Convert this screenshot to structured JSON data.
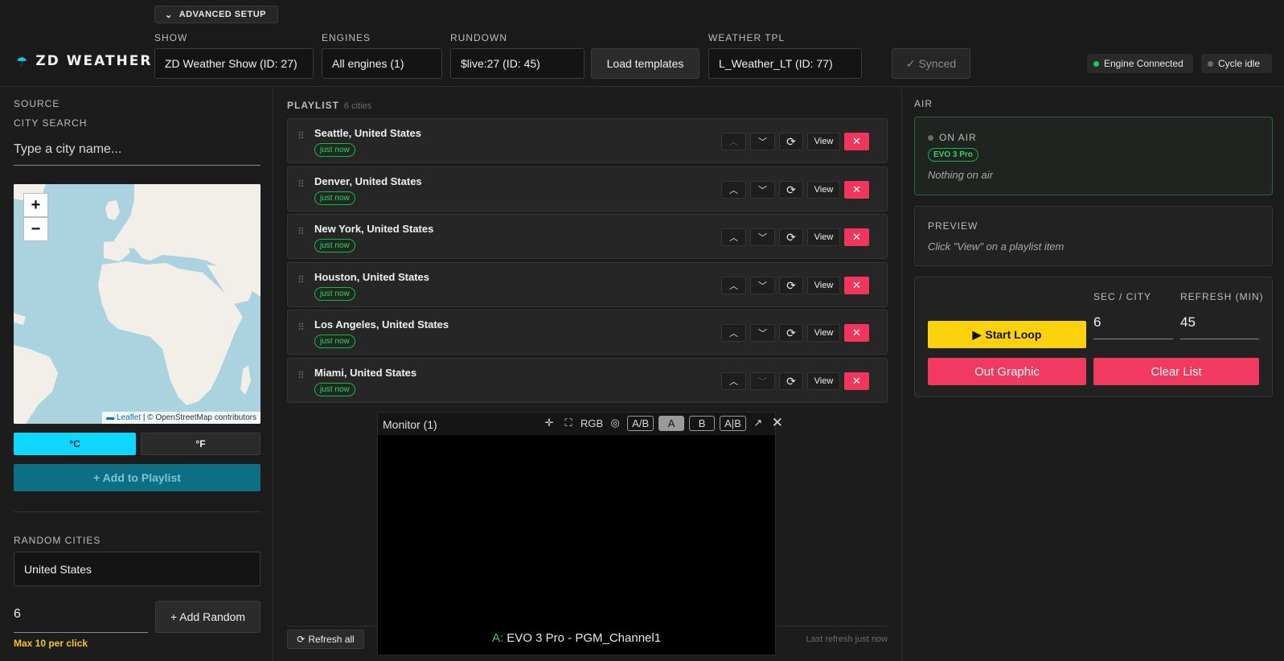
{
  "header": {
    "app_name": "ZD WEATHER",
    "advanced_setup": "ADVANCED SETUP",
    "show_label": "SHOW",
    "show_value": "ZD Weather Show (ID: 27)",
    "engines_label": "ENGINES",
    "engines_value": "All engines (1)",
    "rundown_label": "RUNDOWN",
    "rundown_value": "$live:27 (ID: 45)",
    "load_templates": "Load templates",
    "weather_tpl_label": "WEATHER TPL",
    "weather_tpl_value": "L_Weather_LT (ID: 77)",
    "synced": "✓ Synced",
    "engine_status": "Engine Connected",
    "engine_status_color": "#22c55e",
    "cycle_status": "Cycle idle",
    "cycle_status_color": "#6b6b6b"
  },
  "left": {
    "source_label": "SOURCE",
    "city_search_label": "CITY SEARCH",
    "city_search_placeholder": "Type a city name...",
    "map": {
      "zoom_in": "+",
      "zoom_out": "−",
      "attribution_leaflet": "Leaflet",
      "attribution_rest": "| © OpenStreetMap contributors"
    },
    "unit_c": "°C",
    "unit_f": "°F",
    "active_unit_color": "#0fd6ff",
    "add_to_playlist": "+ Add to Playlist",
    "random_cities_label": "RANDOM CITIES",
    "random_country": "United States",
    "random_count": "6",
    "add_random": "+ Add Random",
    "max_note": "Max 10 per click"
  },
  "playlist": {
    "title": "PLAYLIST",
    "count": "6 cities",
    "view_label": "View",
    "items": [
      {
        "city": "Seattle, United States",
        "badge": "just now"
      },
      {
        "city": "Denver, United States",
        "badge": "just now"
      },
      {
        "city": "New York, United States",
        "badge": "just now"
      },
      {
        "city": "Houston, United States",
        "badge": "just now"
      },
      {
        "city": "Los Angeles, United States",
        "badge": "just now"
      },
      {
        "city": "Miami, United States",
        "badge": "just now"
      }
    ],
    "refresh_all": "Refresh all",
    "last_refresh": "Last refresh just now"
  },
  "monitor": {
    "title": "Monitor (1)",
    "rgb": "RGB",
    "ab": "A/B",
    "a": "A",
    "b": "B",
    "aib": "A|B",
    "channel_prefix": "A:",
    "channel": "EVO 3 Pro - PGM_Channel1"
  },
  "right": {
    "air_label": "AIR",
    "on_air": "ON AIR",
    "engine_badge": "EVO 3 Pro",
    "nothing_on_air": "Nothing on air",
    "preview_label": "PREVIEW",
    "preview_hint": "Click \"View\" on a playlist item",
    "sec_city_label": "SEC / CITY",
    "sec_city_value": "6",
    "refresh_label": "REFRESH (MIN)",
    "refresh_value": "45",
    "start_loop": "Start Loop",
    "out_graphic": "Out Graphic",
    "clear_list": "Clear List"
  }
}
